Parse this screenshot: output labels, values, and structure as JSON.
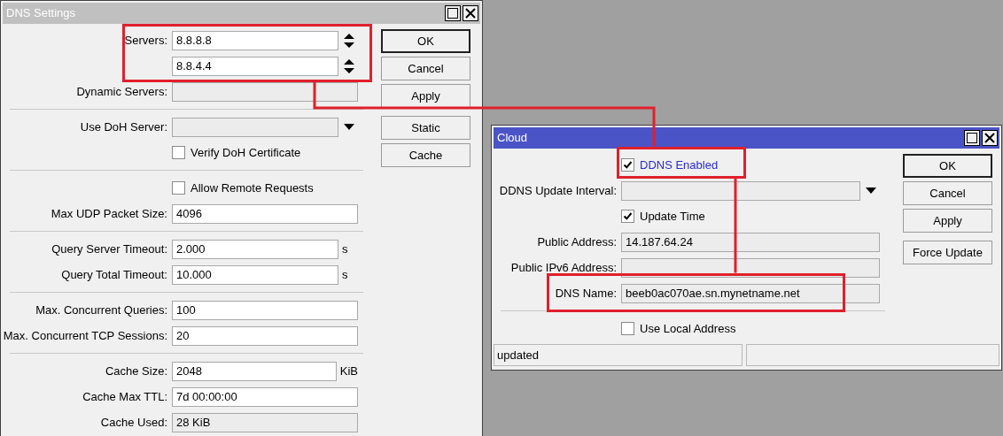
{
  "windows": [
    {
      "title": "DNS Settings",
      "active": false,
      "rows": [
        {
          "kind": "spin",
          "label": "Servers:",
          "value": "8.8.8.8",
          "readonly": false
        },
        {
          "kind": "spin",
          "value": "8.8.4.4",
          "readonly": false
        },
        {
          "kind": "field",
          "label": "Dynamic Servers:",
          "readonly": true
        },
        {
          "kind": "separator"
        },
        {
          "kind": "dropdown",
          "label": "Use DoH Server:",
          "readonly": true
        },
        {
          "kind": "checkbox",
          "label": "Verify DoH Certificate",
          "checked": false,
          "changed": false
        },
        {
          "kind": "separator"
        },
        {
          "kind": "checkbox",
          "label": "Allow Remote Requests",
          "checked": false,
          "changed": false
        },
        {
          "kind": "field",
          "label": "Max UDP Packet Size:",
          "value": "4096",
          "readonly": false
        },
        {
          "kind": "separator"
        },
        {
          "kind": "field",
          "label": "Query Server Timeout:",
          "value": "2.000",
          "unit": "s",
          "readonly": false
        },
        {
          "kind": "field",
          "label": "Query Total Timeout:",
          "value": "10.000",
          "unit": "s",
          "readonly": false
        },
        {
          "kind": "separator"
        },
        {
          "kind": "field",
          "label": "Max. Concurrent Queries:",
          "value": "100",
          "readonly": false
        },
        {
          "kind": "field",
          "label": "Max. Concurrent TCP Sessions:",
          "value": "20",
          "readonly": false
        },
        {
          "kind": "separator"
        },
        {
          "kind": "field",
          "label": "Cache Size:",
          "value": "2048",
          "unit": "KiB",
          "readonly": false
        },
        {
          "kind": "field",
          "label": "Cache Max TTL:",
          "value": "7d 00:00:00",
          "readonly": false
        },
        {
          "kind": "field",
          "label": "Cache Used:",
          "value": "28 KiB",
          "readonly": true
        }
      ],
      "buttons": [
        {
          "label": "OK",
          "default": true
        },
        {
          "label": "Cancel",
          "default": false
        },
        {
          "label": "Apply",
          "default": false
        },
        {
          "label": "Static",
          "default": false
        },
        {
          "label": "Cache",
          "default": false
        }
      ]
    },
    {
      "title": "Cloud",
      "active": true,
      "rows": [
        {
          "kind": "checkbox",
          "label": "DDNS Enabled",
          "checked": true,
          "changed": true
        },
        {
          "kind": "dropdown",
          "label": "DDNS Update Interval:",
          "readonly": true
        },
        {
          "kind": "checkbox",
          "label": "Update Time",
          "checked": true,
          "changed": false
        },
        {
          "kind": "field",
          "label": "Public Address:",
          "value": "14.187.64.24",
          "readonly": true
        },
        {
          "kind": "field",
          "label": "Public IPv6 Address:",
          "readonly": true
        },
        {
          "kind": "field",
          "label": "DNS Name:",
          "value": "beeb0ac070ae.sn.mynetname.net",
          "readonly": true
        },
        {
          "kind": "separator"
        },
        {
          "kind": "checkbox",
          "label": "Use Local Address",
          "checked": false,
          "changed": false
        }
      ],
      "buttons": [
        {
          "label": "OK",
          "default": true
        },
        {
          "label": "Cancel",
          "default": false
        },
        {
          "label": "Apply",
          "default": false
        },
        {
          "label": "Force Update",
          "default": false
        }
      ],
      "status_bar": [
        "updated"
      ]
    }
  ]
}
